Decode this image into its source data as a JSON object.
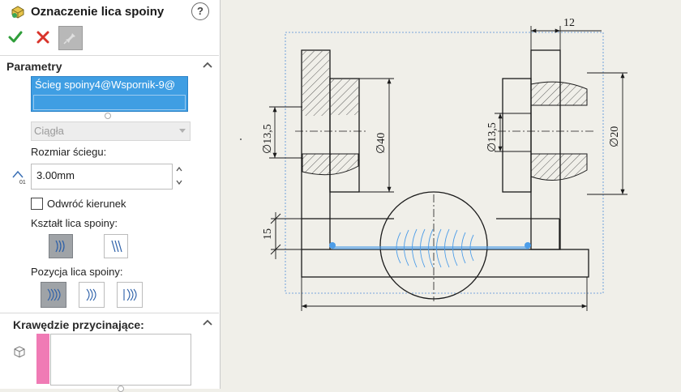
{
  "panel": {
    "title": "Oznaczenie lica spoiny",
    "help_label": "?",
    "sections": {
      "parameters": {
        "title": "Parametry",
        "selection_value": "Ścieg spoiny4@Wspornik-9@",
        "type_value": "Ciągła",
        "bead_size_label": "Rozmiar ściegu:",
        "bead_size_value": "3.00mm",
        "reverse_label": "Odwróć kierunek",
        "reverse_checked": false,
        "shape_label": "Kształt lica spoiny:",
        "position_label": "Pozycja lica spoiny:",
        "position_selected": 0
      },
      "trim": {
        "title": "Krawędzie przycinające:",
        "list_color": "#f07bb5"
      }
    }
  },
  "drawing": {
    "dim_top": "12",
    "dim_left_diam": "∅13,5",
    "dim_mid_diam": "∅40",
    "dim_right_diam": "∅13,5",
    "dim_far_right_diam": "∅20",
    "dim_height": "15",
    "weld_color": "#4d9de8",
    "line_color": "#1a1a1a"
  }
}
